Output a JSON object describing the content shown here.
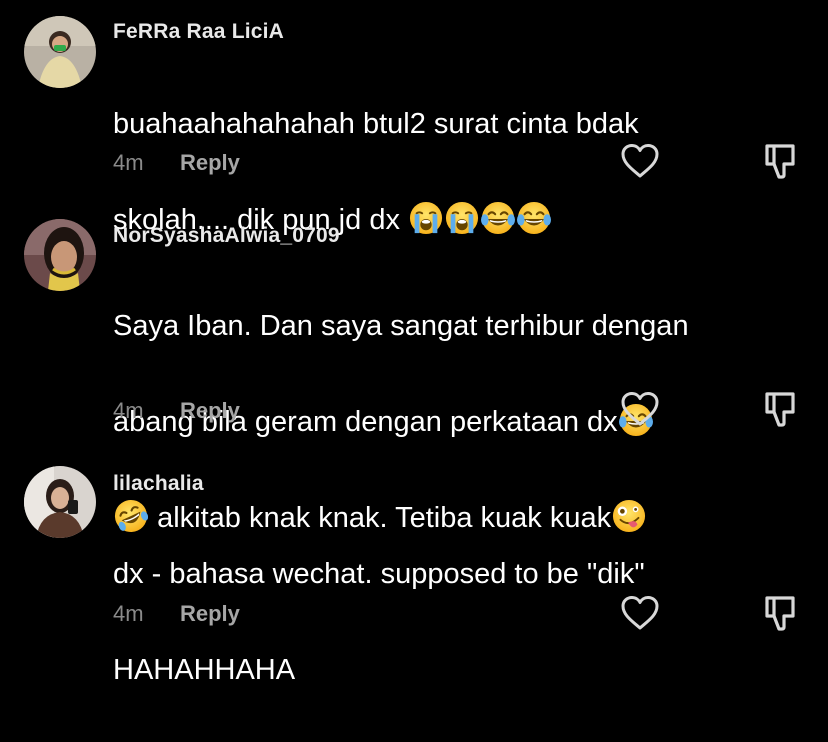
{
  "comments": [
    {
      "username": "FeRRa Raa LiciA",
      "text_line1": "buahaahahahahah btul2 surat cinta bdak",
      "text_line2": "skolah.... dik pun jd dx",
      "emojis_line2": [
        "loudly-crying-face",
        "loudly-crying-face",
        "face-with-tears-of-joy",
        "face-with-tears-of-joy"
      ],
      "time": "4m",
      "reply_label": "Reply"
    },
    {
      "username": "NorSyashaAlwia_0709",
      "text_line1": "Saya Iban. Dan saya sangat terhibur dengan",
      "text_line2": "abang bila geram dengan perkataan dx",
      "text_line3": "alkitab knak knak. Tetiba kuak kuak",
      "emojis": [
        "face-with-tears-of-joy",
        "rolling-on-the-floor-laughing",
        "zany-face"
      ],
      "time": "4m",
      "reply_label": "Reply"
    },
    {
      "username": "lilachalia",
      "text_line1": "dx - bahasa wechat. supposed to be \"dik\"",
      "text_line2": "HAHAHHAHA",
      "time": "4m",
      "reply_label": "Reply"
    }
  ],
  "colors": {
    "background": "#000000",
    "text": "#ffffff",
    "meta": "#8a8a8a",
    "reply": "#a6a6a6"
  }
}
